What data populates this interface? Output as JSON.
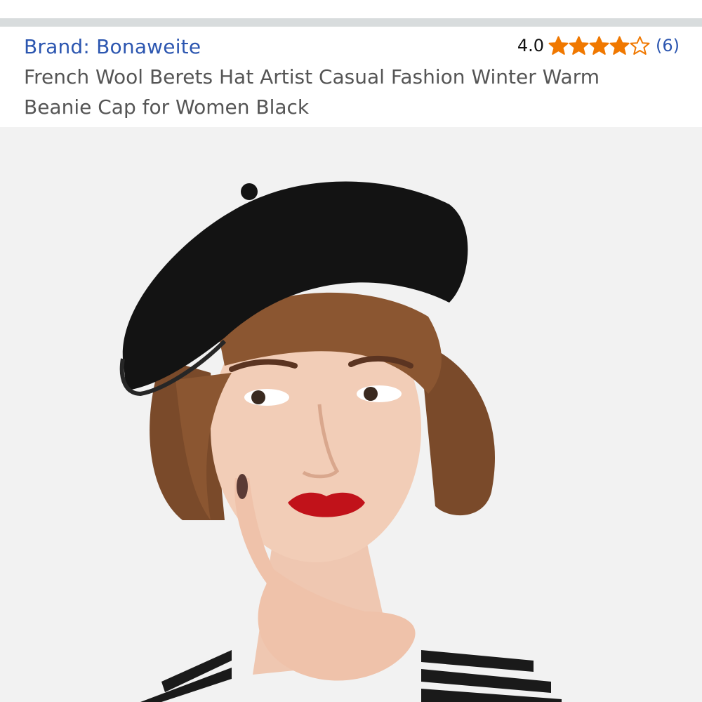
{
  "product": {
    "brand_label": "Brand: Bonaweite",
    "rating": {
      "value": "4.0",
      "stars_filled": 4,
      "stars_total": 5,
      "review_count": "(6)"
    },
    "title": "French Wool Berets Hat Artist Casual Fashion Winter Warm Beanie Cap for Women Black"
  },
  "colors": {
    "link": "#2c56b0",
    "star": "#f07800",
    "title_text": "#555555",
    "photo_bg": "#f2f2f2"
  },
  "icons": {
    "star_filled": "star-icon",
    "star_empty": "star-outline-icon"
  }
}
